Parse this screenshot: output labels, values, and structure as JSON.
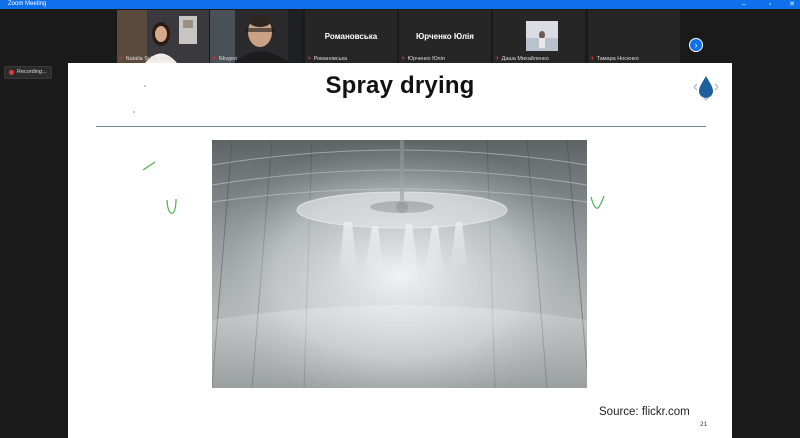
{
  "window": {
    "title": "Zoom Meeting",
    "minimize_icon": "minimize-icon",
    "maximize_icon": "restore-icon",
    "close_icon": "close-icon"
  },
  "participants": [
    {
      "name": "Natalia Sukachevа",
      "video": true
    },
    {
      "name": "Nkvgen",
      "video": true
    },
    {
      "name": "Романовська",
      "display": "Романовська",
      "video": false
    },
    {
      "name": "Юрченко Юлія",
      "display": "Юрченко Юлія",
      "video": false
    },
    {
      "name": "Даша Михайленко",
      "video": true
    },
    {
      "name": "Тамара Носенко",
      "display": "",
      "video": false
    }
  ],
  "recording": {
    "label": "Recording..."
  },
  "slide": {
    "title": "Spray drying",
    "source": "Source: flickr.com",
    "page_number": "21"
  },
  "colors": {
    "accent": "#0e71eb",
    "mic_muted": "#e53935",
    "annotation": "#4caf50",
    "rule": "#6b8a92"
  }
}
